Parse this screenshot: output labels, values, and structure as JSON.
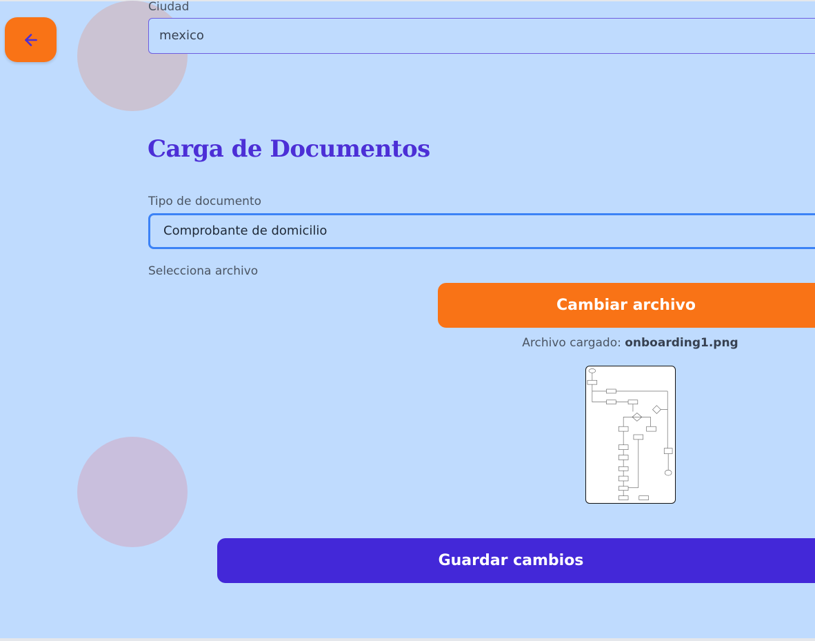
{
  "colors": {
    "background": "#bfdbfe",
    "accent_orange": "#f97316",
    "primary_indigo": "#4328d8",
    "title": "#4c2fd6",
    "focus_ring": "#3b82f6"
  },
  "back_button": {
    "icon": "arrow-left-icon"
  },
  "city_field": {
    "label": "Ciudad",
    "value": "mexico"
  },
  "documents": {
    "title": "Carga de Documentos",
    "doc_type_label": "Tipo de documento",
    "doc_type_value": "Comprobante de domicilio",
    "file_label": "Selecciona archivo",
    "change_file_label": "Cambiar archivo",
    "uploaded_prefix": "Archivo cargado: ",
    "uploaded_file_name": "onboarding1.png"
  },
  "save_button_label": "Guardar cambios"
}
